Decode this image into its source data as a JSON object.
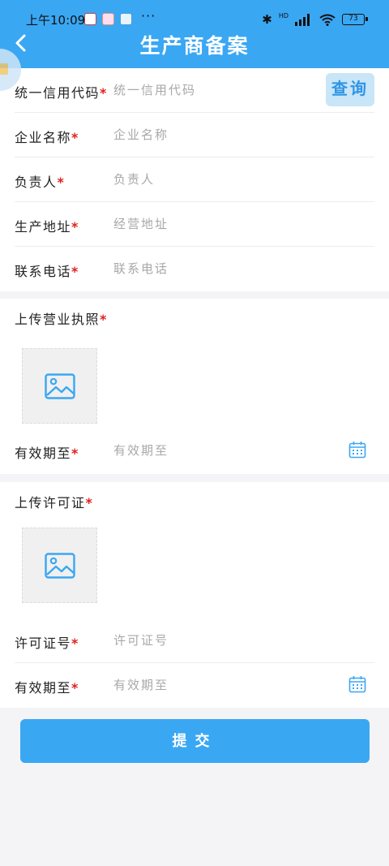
{
  "status_bar": {
    "time": "上午10:09",
    "dots": "···",
    "bluetooth": "✱",
    "network": "HD",
    "battery": "73"
  },
  "header": {
    "title": "生产商备案",
    "back_icon": "chevron-left-icon"
  },
  "required_mark": "*",
  "basic_info": {
    "credit_code": {
      "label": "统一信用代码",
      "placeholder": "统一信用代码",
      "value": ""
    },
    "query_button": "查询",
    "company_name": {
      "label": "企业名称",
      "placeholder": "企业名称",
      "value": ""
    },
    "person_in_charge": {
      "label": "负责人",
      "placeholder": "负责人",
      "value": ""
    },
    "production_address": {
      "label": "生产地址",
      "placeholder": "经营地址",
      "value": ""
    },
    "contact_phone": {
      "label": "联系电话",
      "placeholder": "联系电话",
      "value": ""
    }
  },
  "business_license": {
    "section_title": "上传营业执照",
    "upload_icon": "image-icon",
    "valid_until": {
      "label": "有效期至",
      "placeholder": "有效期至",
      "value": ""
    },
    "calendar_icon": "calendar-icon"
  },
  "permit": {
    "section_title": "上传许可证",
    "upload_icon": "image-icon",
    "permit_number": {
      "label": "许可证号",
      "placeholder": "许可证号",
      "value": ""
    },
    "valid_until": {
      "label": "有效期至",
      "placeholder": "有效期至",
      "value": ""
    },
    "calendar_icon": "calendar-icon"
  },
  "submit_button": "提交",
  "colors": {
    "primary": "#3aa7f3",
    "required": "#e02020",
    "placeholder": "#a8a8a8",
    "query_bg": "#c9e5f8"
  }
}
